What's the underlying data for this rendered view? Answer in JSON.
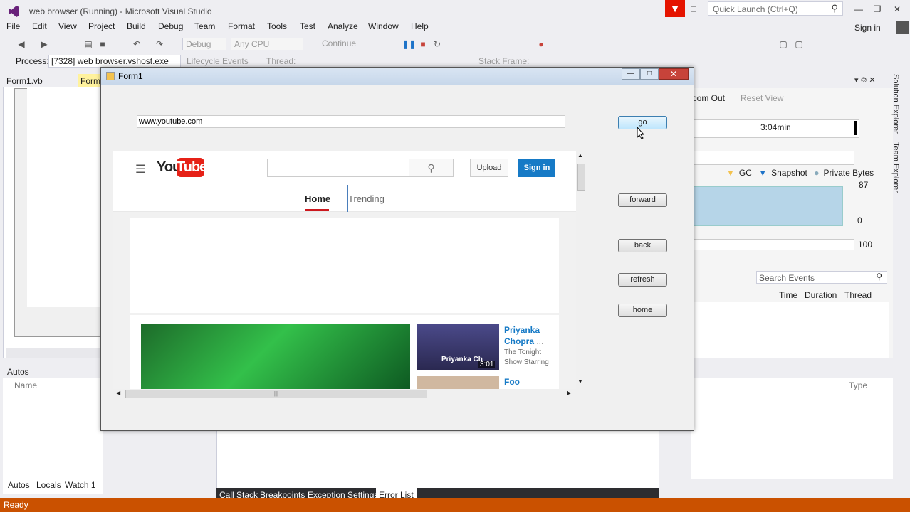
{
  "vs": {
    "title": "web browser (Running) - Microsoft Visual Studio",
    "quick_launch_placeholder": "Quick Launch (Ctrl+Q)",
    "menu": [
      "File",
      "Edit",
      "View",
      "Project",
      "Build",
      "Debug",
      "Team",
      "Format",
      "Tools",
      "Test",
      "Analyze",
      "Window",
      "Help"
    ],
    "sign_in": "Sign in",
    "toolbar": {
      "config": "Debug",
      "platform": "Any CPU",
      "continue_label": "Continue"
    },
    "process_bar": {
      "process_label": "Process:",
      "process_value": "[7328] web browser.vshost.exe",
      "lifecycle_label": "Lifecycle Events",
      "thread_label": "Thread:",
      "stack_frame_label": "Stack Frame:"
    },
    "doc_tabs": [
      "Form1.vb",
      "Form"
    ],
    "autos": {
      "title": "Autos",
      "col_name": "Name",
      "tabs": [
        "Autos",
        "Locals",
        "Watch 1"
      ]
    },
    "diagnostics": {
      "zoom_out": "oom Out",
      "reset_view": "Reset View",
      "time_label": "3:04min",
      "legend": [
        "GC",
        "Snapshot",
        "Private Bytes"
      ],
      "mem_max": "87",
      "mem_min": "0",
      "pct": "100",
      "search_placeholder": "Search Events",
      "event_cols": [
        "Time",
        "Duration",
        "Thread"
      ],
      "type_col": "Type"
    },
    "side_tabs": [
      "Solution Explorer",
      "Team Explorer"
    ],
    "bottom_tabs": [
      "Call Stack",
      "Breakpoints",
      "Exception Settings",
      "Error List"
    ],
    "status": "Ready"
  },
  "form1": {
    "title": "Form1",
    "url": "www.youtube.com",
    "buttons": {
      "go": "go",
      "forward": "forward",
      "back": "back",
      "refresh": "refresh",
      "home": "home"
    }
  },
  "youtube": {
    "logo_you": "You",
    "logo_tube": "Tube",
    "upload": "Upload",
    "signin": "Sign in",
    "nav_home": "Home",
    "nav_trending": "Trending",
    "video1_title": "Priyanka Chopra",
    "video1_ellipsis": "...",
    "video1_desc": "The Tonight Show Starring",
    "video1_thumb_text": "Priyanka Ch",
    "video1_duration": "3:01",
    "video2_title": "Foo"
  },
  "colors": {
    "status_bar": "#CA5100",
    "accent_red": "#E51400",
    "yt_blue": "#167AC6",
    "yt_red": "#CC181E"
  }
}
